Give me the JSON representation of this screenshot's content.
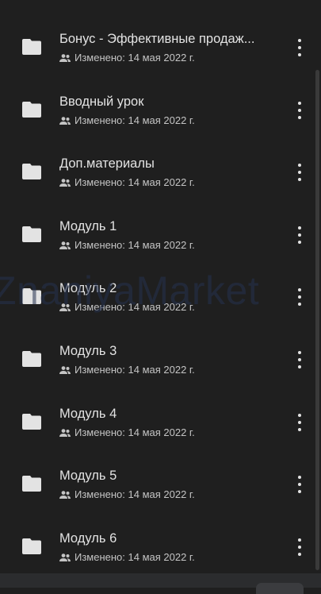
{
  "watermark": "ZnaniyaMarket",
  "modified_label": "Изменено: 14 мая 2022 г.",
  "items": [
    {
      "title": "Бонус - Эффективные продаж...",
      "meta": "Изменено: 14 мая 2022 г."
    },
    {
      "title": "Вводный урок",
      "meta": "Изменено: 14 мая 2022 г."
    },
    {
      "title": "Доп.материалы",
      "meta": "Изменено: 14 мая 2022 г."
    },
    {
      "title": "Модуль 1",
      "meta": "Изменено: 14 мая 2022 г."
    },
    {
      "title": "Модуль 2",
      "meta": "Изменено: 14 мая 2022 г."
    },
    {
      "title": "Модуль 3",
      "meta": "Изменено: 14 мая 2022 г."
    },
    {
      "title": "Модуль 4",
      "meta": "Изменено: 14 мая 2022 г."
    },
    {
      "title": "Модуль 5",
      "meta": "Изменено: 14 мая 2022 г."
    },
    {
      "title": "Модуль 6",
      "meta": "Изменено: 14 мая 2022 г."
    }
  ],
  "icons": {
    "folder": "folder-icon",
    "shared": "shared-people-icon",
    "more": "more-vert-icon"
  },
  "colors": {
    "background": "#1f1f1f",
    "text": "#e3e3e3",
    "secondary": "#c4c4c4",
    "folder": "#e3e3e3"
  }
}
